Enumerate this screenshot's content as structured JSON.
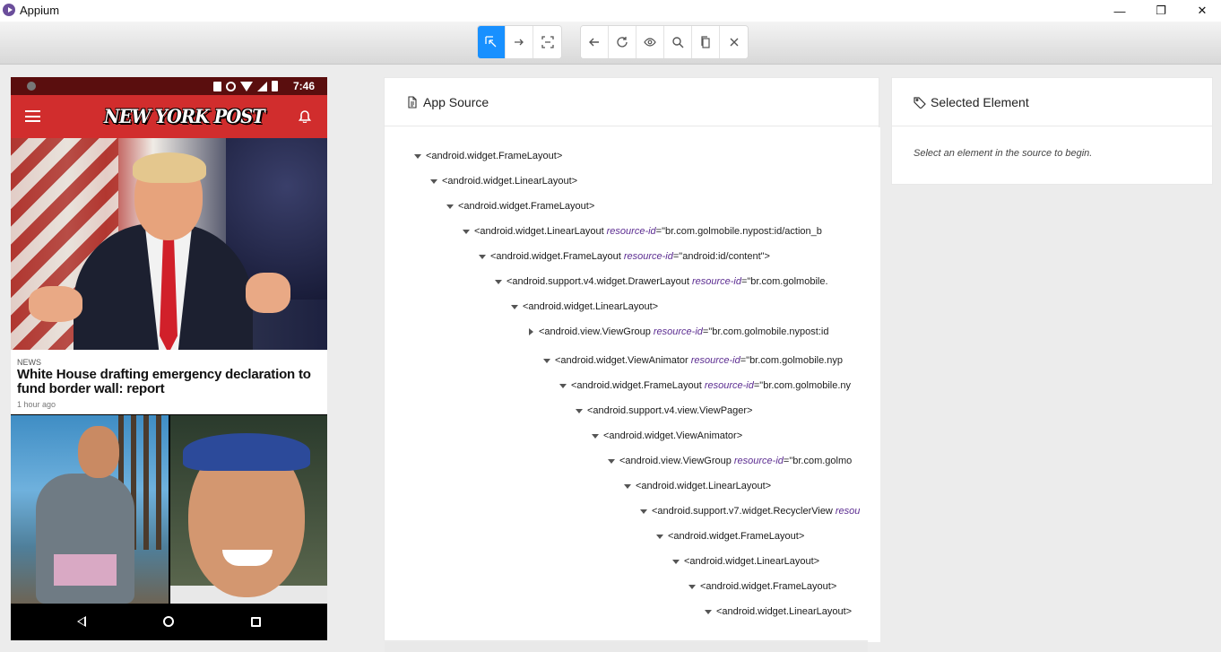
{
  "window": {
    "title": "Appium",
    "minimize": "—",
    "maximize": "❐",
    "close": "✕"
  },
  "toolbar": {
    "group1": [
      {
        "name": "select-elements",
        "icon": "select-arrow-icon",
        "active": true
      },
      {
        "name": "swipe-by-coordinates",
        "icon": "swipe-arrow-icon",
        "active": false
      },
      {
        "name": "tap-by-coordinates",
        "icon": "crosshair-icon",
        "active": false
      }
    ],
    "group2": [
      {
        "name": "back",
        "icon": "back-arrow-icon"
      },
      {
        "name": "refresh",
        "icon": "refresh-icon"
      },
      {
        "name": "start-recording",
        "icon": "eye-icon"
      },
      {
        "name": "search-for-element",
        "icon": "search-icon"
      },
      {
        "name": "copy-xml-source",
        "icon": "copy-icon"
      },
      {
        "name": "quit-session",
        "icon": "close-icon"
      }
    ],
    "accent": "#1890ff"
  },
  "device": {
    "status_time": "7:46",
    "brand": "NEW YORK POST",
    "article": {
      "category": "NEWS",
      "headline": "White House drafting emergency declaration to fund border wall: report",
      "time": "1 hour ago"
    },
    "header_color": "#d12d2d"
  },
  "source": {
    "title": "App Source",
    "nodes": [
      {
        "tag": "<android.widget.FrameLayout>",
        "attr": "",
        "val": "",
        "expanded": true
      },
      {
        "tag": "<android.widget.LinearLayout>",
        "attr": "",
        "val": "",
        "expanded": true
      },
      {
        "tag": "<android.widget.FrameLayout>",
        "attr": "",
        "val": "",
        "expanded": true
      },
      {
        "tag": "<android.widget.LinearLayout",
        "attr": "resource-id",
        "val": "=\"br.com.golmobile.nypost:id/action_b",
        "expanded": true
      },
      {
        "tag": "<android.widget.FrameLayout",
        "attr": "resource-id",
        "val": "=\"android:id/content\">",
        "expanded": true
      },
      {
        "tag": "<android.support.v4.widget.DrawerLayout",
        "attr": "resource-id",
        "val": "=\"br.com.golmobile.",
        "expanded": true
      },
      {
        "tag": "<android.widget.LinearLayout>",
        "attr": "",
        "val": "",
        "expanded": true
      },
      {
        "tag": "<android.view.ViewGroup",
        "attr": "resource-id",
        "val": "=\"br.com.golmobile.nypost:id",
        "expanded": false
      },
      {
        "tag": "<android.widget.ViewAnimator",
        "attr": "resource-id",
        "val": "=\"br.com.golmobile.nyp",
        "expanded": true
      },
      {
        "tag": "<android.widget.FrameLayout",
        "attr": "resource-id",
        "val": "=\"br.com.golmobile.ny",
        "expanded": true
      },
      {
        "tag": "<android.support.v4.view.ViewPager>",
        "attr": "",
        "val": "",
        "expanded": true
      },
      {
        "tag": "<android.widget.ViewAnimator>",
        "attr": "",
        "val": "",
        "expanded": true
      },
      {
        "tag": "<android.view.ViewGroup",
        "attr": "resource-id",
        "val": "=\"br.com.golmo",
        "expanded": true
      },
      {
        "tag": "<android.widget.LinearLayout>",
        "attr": "",
        "val": "",
        "expanded": true
      },
      {
        "tag": "<android.support.v7.widget.RecyclerView",
        "attr": "resou",
        "val": "",
        "expanded": true
      },
      {
        "tag": "<android.widget.FrameLayout>",
        "attr": "",
        "val": "",
        "expanded": true
      },
      {
        "tag": "<android.widget.LinearLayout>",
        "attr": "",
        "val": "",
        "expanded": true
      },
      {
        "tag": "<android.widget.FrameLayout>",
        "attr": "",
        "val": "",
        "expanded": true
      },
      {
        "tag": "<android.widget.LinearLayout>",
        "attr": "",
        "val": "",
        "expanded": true
      }
    ]
  },
  "selected": {
    "title": "Selected Element",
    "hint": "Select an element in the source to begin."
  }
}
